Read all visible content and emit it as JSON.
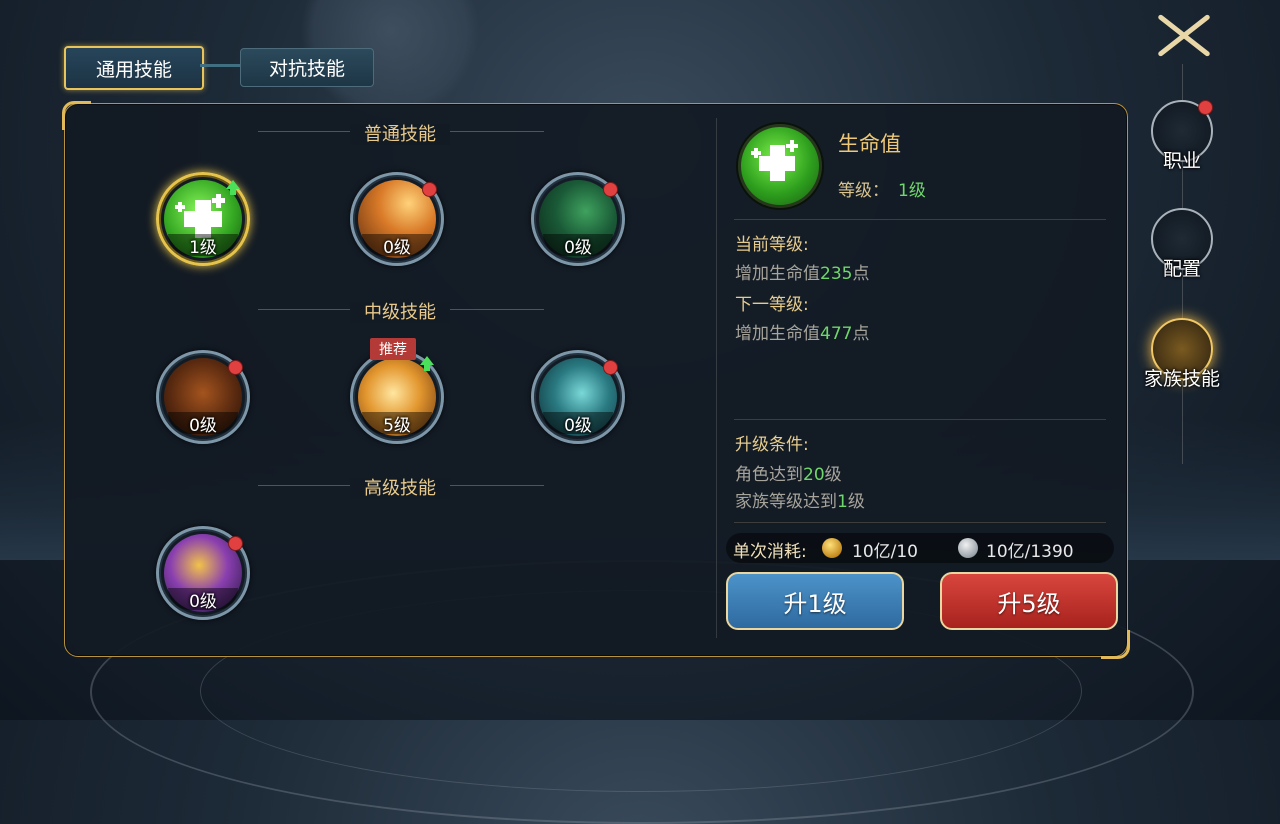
{
  "tabs": {
    "general": "通用技能",
    "pvp": "对抗技能"
  },
  "sections": {
    "normal": "普通技能",
    "mid": "中级技能",
    "high": "高级技能"
  },
  "skills": [
    {
      "level": "1级"
    },
    {
      "level": "0级"
    },
    {
      "level": "0级"
    },
    {
      "level": "0级"
    },
    {
      "level": "5级",
      "tag": "推荐"
    },
    {
      "level": "0级"
    },
    {
      "level": "0级"
    }
  ],
  "detail": {
    "name": "生命值",
    "level_label": "等级：",
    "level_value": "1级",
    "current_label": "当前等级:",
    "current_text_pre": "增加生命值",
    "current_value": "235",
    "current_text_post": "点",
    "next_label": "下一等级:",
    "next_text_pre": "增加生命值",
    "next_value": "477",
    "next_text_post": "点",
    "cond_label": "升级条件:",
    "cond1_pre": "角色达到",
    "cond1_value": "20",
    "cond1_post": "级",
    "cond2_pre": "家族等级达到",
    "cond2_value": "1",
    "cond2_post": "级"
  },
  "cost": {
    "label": "单次消耗:",
    "gold": "10亿/10",
    "silver": "10亿/1390"
  },
  "buttons": {
    "up1": "升1级",
    "up5": "升5级"
  },
  "side": {
    "job": "职业",
    "config": "配置",
    "family": "家族技能"
  },
  "colors": {
    "accent_gold": "#e6c44c",
    "value_green": "#6fd86a",
    "button_blue": "#2e6aa0",
    "button_red": "#a8221d"
  }
}
